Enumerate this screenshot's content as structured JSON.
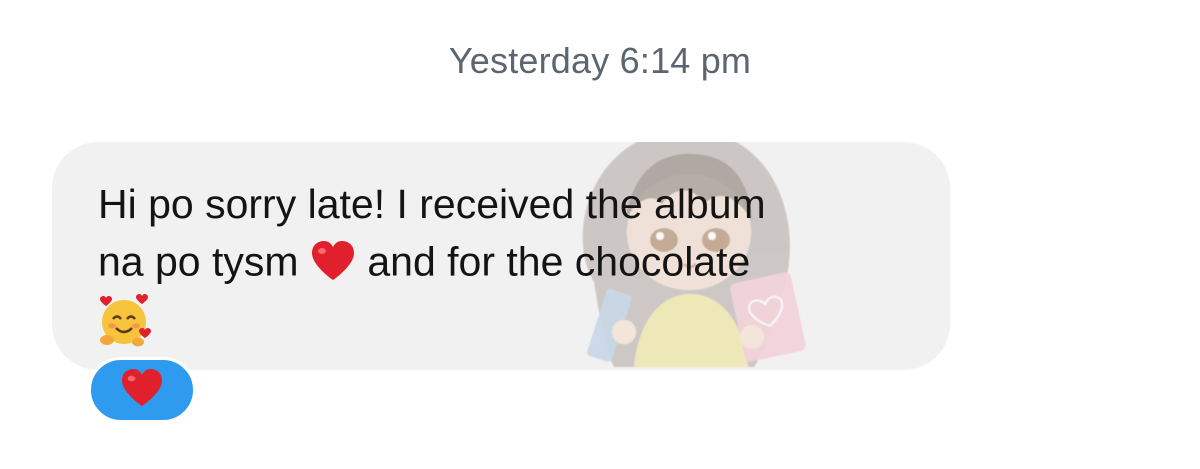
{
  "conversation": {
    "timestamp": "Yesterday 6:14 pm",
    "message": {
      "line1": "Hi po sorry late! I received the album",
      "line2_before": "na po tysm",
      "line2_emoji": "red-heart-icon",
      "line2_after": "and for the chocolate",
      "line3_emoji": "smiling-face-with-hearts-icon"
    },
    "reaction": {
      "emoji": "red-heart-icon",
      "color": "#2f9bee"
    },
    "bubble_color": "#f1f1f1",
    "watermark": "cartoon-girl-with-album-and-chocolate"
  }
}
